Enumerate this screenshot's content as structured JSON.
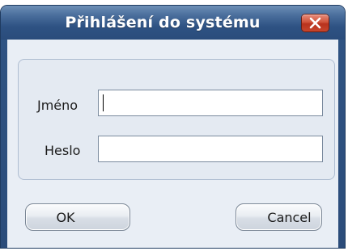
{
  "window": {
    "title": "Přihlášení do systému",
    "close_icon": "close-icon"
  },
  "form": {
    "name_label": "Jméno",
    "name_value": "",
    "password_label": "Heslo",
    "password_value": ""
  },
  "buttons": {
    "ok_label": "OK",
    "cancel_label": "Cancel"
  },
  "colors": {
    "titlebar": "#2e5283",
    "close_button": "#c7452c",
    "client_background": "#e9eef5"
  }
}
